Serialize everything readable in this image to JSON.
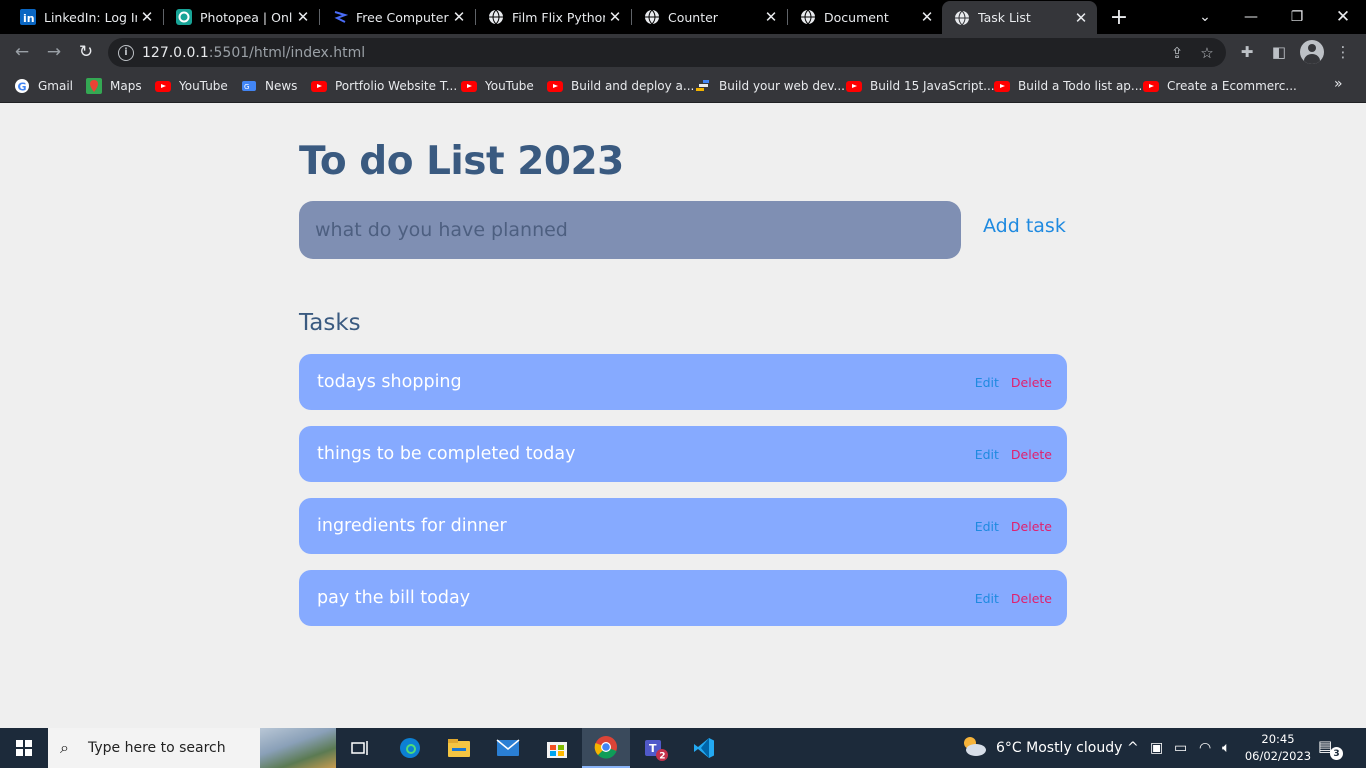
{
  "browser": {
    "tabs": [
      {
        "title": "LinkedIn: Log In or Sign Up",
        "favicon": "linkedin-icon"
      },
      {
        "title": "Photopea | Online Photo Editor",
        "favicon": "photopea-icon"
      },
      {
        "title": "Free Computer Illustrations",
        "favicon": "freepik-icon"
      },
      {
        "title": "Film Flix Python App",
        "favicon": "globe-icon"
      },
      {
        "title": "Counter",
        "favicon": "globe-icon"
      },
      {
        "title": "Document",
        "favicon": "globe-icon"
      },
      {
        "title": "Task List",
        "favicon": "globe-icon",
        "active": true
      }
    ],
    "address": {
      "host": "127.0.0.1",
      "rest": ":5501/html/index.html"
    },
    "bookmarks": [
      {
        "label": "Gmail",
        "icon": "google-icon"
      },
      {
        "label": "Maps",
        "icon": "maps-icon"
      },
      {
        "label": "YouTube",
        "icon": "youtube-icon"
      },
      {
        "label": "News",
        "icon": "news-icon"
      },
      {
        "label": "Portfolio Website T...",
        "icon": "youtube-icon"
      },
      {
        "label": "YouTube",
        "icon": "youtube-icon"
      },
      {
        "label": "Build and deploy a...",
        "icon": "youtube-icon"
      },
      {
        "label": "Build your web dev...",
        "icon": "bookmark-icon"
      },
      {
        "label": "Build 15 JavaScript...",
        "icon": "youtube-icon"
      },
      {
        "label": "Build a Todo list ap...",
        "icon": "youtube-icon"
      },
      {
        "label": "Create a Ecommerc...",
        "icon": "youtube-icon"
      }
    ]
  },
  "app": {
    "title": "To do List 2023",
    "input_placeholder": "what do you have planned",
    "add_label": "Add task",
    "tasks_heading": "Tasks",
    "edit_label": "Edit",
    "delete_label": "Delete",
    "tasks": [
      "todays shopping",
      "things to be completed today",
      "ingredients for dinner",
      "pay the bill today"
    ]
  },
  "taskbar": {
    "search_placeholder": "Type here to search",
    "weather": "6°C  Mostly cloudy",
    "time": "20:45",
    "date": "06/02/2023",
    "notification_count": "3",
    "teams_badge": "2"
  },
  "colors": {
    "title": "#3a5a80",
    "task_bg": "#86aaff",
    "input_bg": "#7f8fb3",
    "link_blue": "#1f8ae0",
    "delete_red": "#e0206e"
  }
}
